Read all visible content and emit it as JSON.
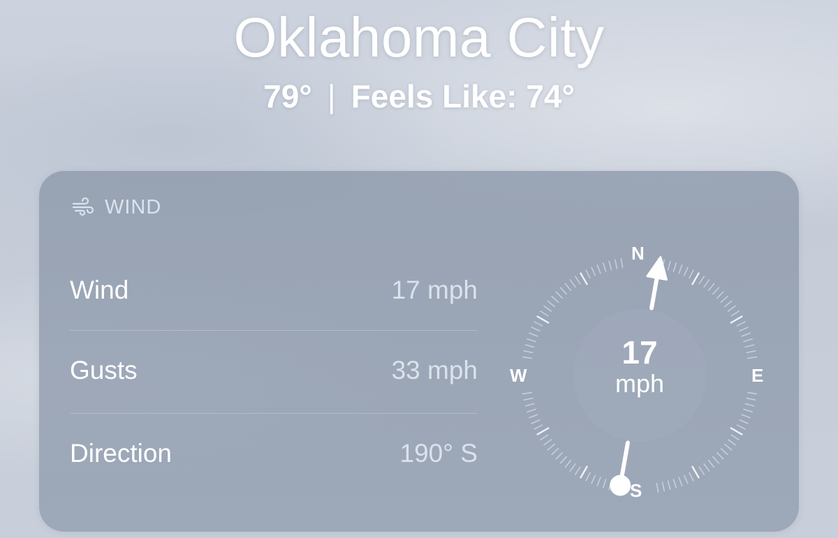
{
  "header": {
    "city": "Oklahoma City",
    "temperature": "79°",
    "separator": "|",
    "feels_like": "Feels Like: 74°"
  },
  "wind_card": {
    "title": "WIND",
    "title_icon": "wind-icon",
    "rows": [
      {
        "label": "Wind",
        "value": "17 mph"
      },
      {
        "label": "Gusts",
        "value": "33 mph"
      },
      {
        "label": "Direction",
        "value": "190° S"
      }
    ],
    "compass": {
      "speed": "17",
      "unit": "mph",
      "north": "N",
      "east": "E",
      "south": "S",
      "west": "W",
      "direction_degrees": 190
    }
  }
}
